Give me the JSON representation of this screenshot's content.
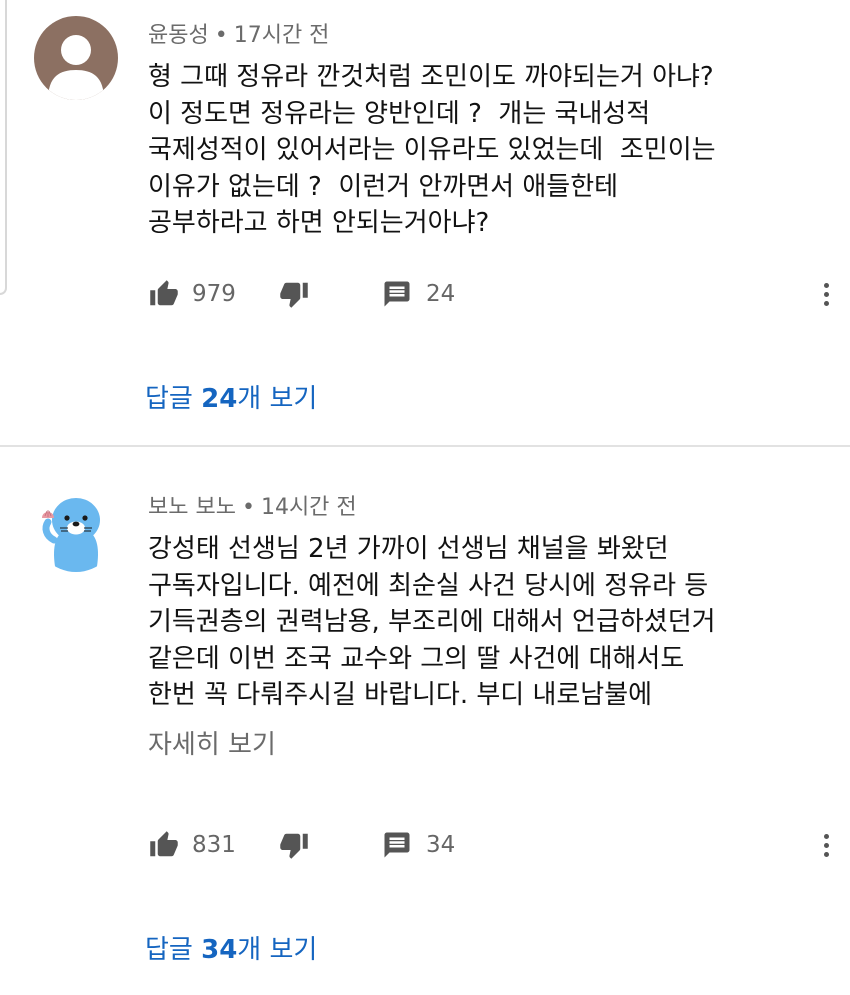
{
  "comments": [
    {
      "author": "윤동성",
      "time": "17시간 전",
      "text": "형 그때 정유라 깐것처럼 조민이도 까야되는거 아냐?\n이 정도면 정유라는 양반인데 ?  개는 국내성적\n국제성적이 있어서라는 이유라도 있었는데  조민이는\n이유가 없는데 ?  이런거 안까면서 애들한테\n공부하라고 하면 안되는거아냐?",
      "likes": "979",
      "reply_count": "24",
      "replies_prefix": "답글 ",
      "replies_number": "24",
      "replies_suffix": "개 보기"
    },
    {
      "author": "보노 보노",
      "time": "14시간 전",
      "text": "강성태 선생님 2년 가까이 선생님 채널을 봐왔던\n구독자입니다. 예전에 최순실 사건 당시에 정유라 등\n기득권층의 권력남용, 부조리에 대해서 언급하셨던거\n같은데 이번 조국 교수와 그의 딸 사건에 대해서도\n한번 꼭 다뤄주시길 바랍니다. 부디 내로남불에",
      "show_more": "자세히 보기",
      "likes": "831",
      "reply_count": "34",
      "replies_prefix": "답글 ",
      "replies_number": "34",
      "replies_suffix": "개 보기"
    }
  ],
  "meta_separator": "•",
  "colors": {
    "link": "#1565c0",
    "meta_text": "#6b6b6b",
    "icon": "#555555",
    "default_avatar_bg": "#8c7062",
    "bonobono_blue": "#6ab8ef"
  },
  "icons": [
    "default-avatar-icon",
    "bonobono-avatar",
    "thumbs-up-icon",
    "thumbs-down-icon",
    "comment-icon",
    "more-vert-icon"
  ]
}
